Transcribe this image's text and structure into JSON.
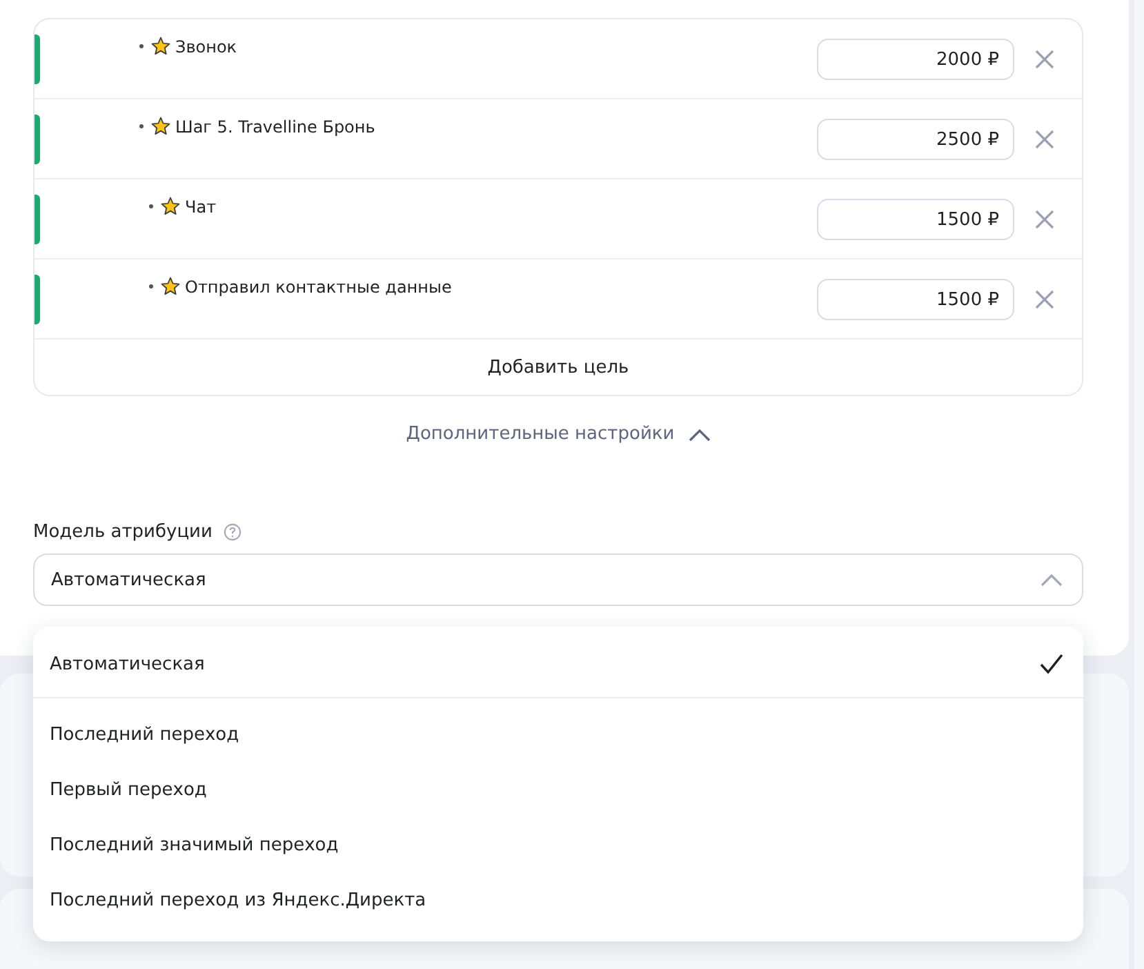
{
  "goals": [
    {
      "name": "Звонок",
      "value": "2000 ₽"
    },
    {
      "name": "Шаг 5. Travelline Бронь",
      "value": "2500 ₽"
    },
    {
      "name": "Чат",
      "value": "1500 ₽"
    },
    {
      "name": "Отправил контактные данные",
      "value": "1500 ₽"
    }
  ],
  "add_goal": "Добавить цель",
  "advanced_settings": {
    "label": "Дополнительные настройки",
    "expanded": true
  },
  "attribution": {
    "label": "Модель атрибуции",
    "value": "Автоматическая",
    "open": true,
    "options": [
      {
        "label": "Автоматическая",
        "selected": true
      },
      {
        "label": "Последний переход",
        "selected": false
      },
      {
        "label": "Первый переход",
        "selected": false
      },
      {
        "label": "Последний значимый переход",
        "selected": false
      },
      {
        "label": "Последний переход из Яндекс.Директа",
        "selected": false
      }
    ]
  }
}
